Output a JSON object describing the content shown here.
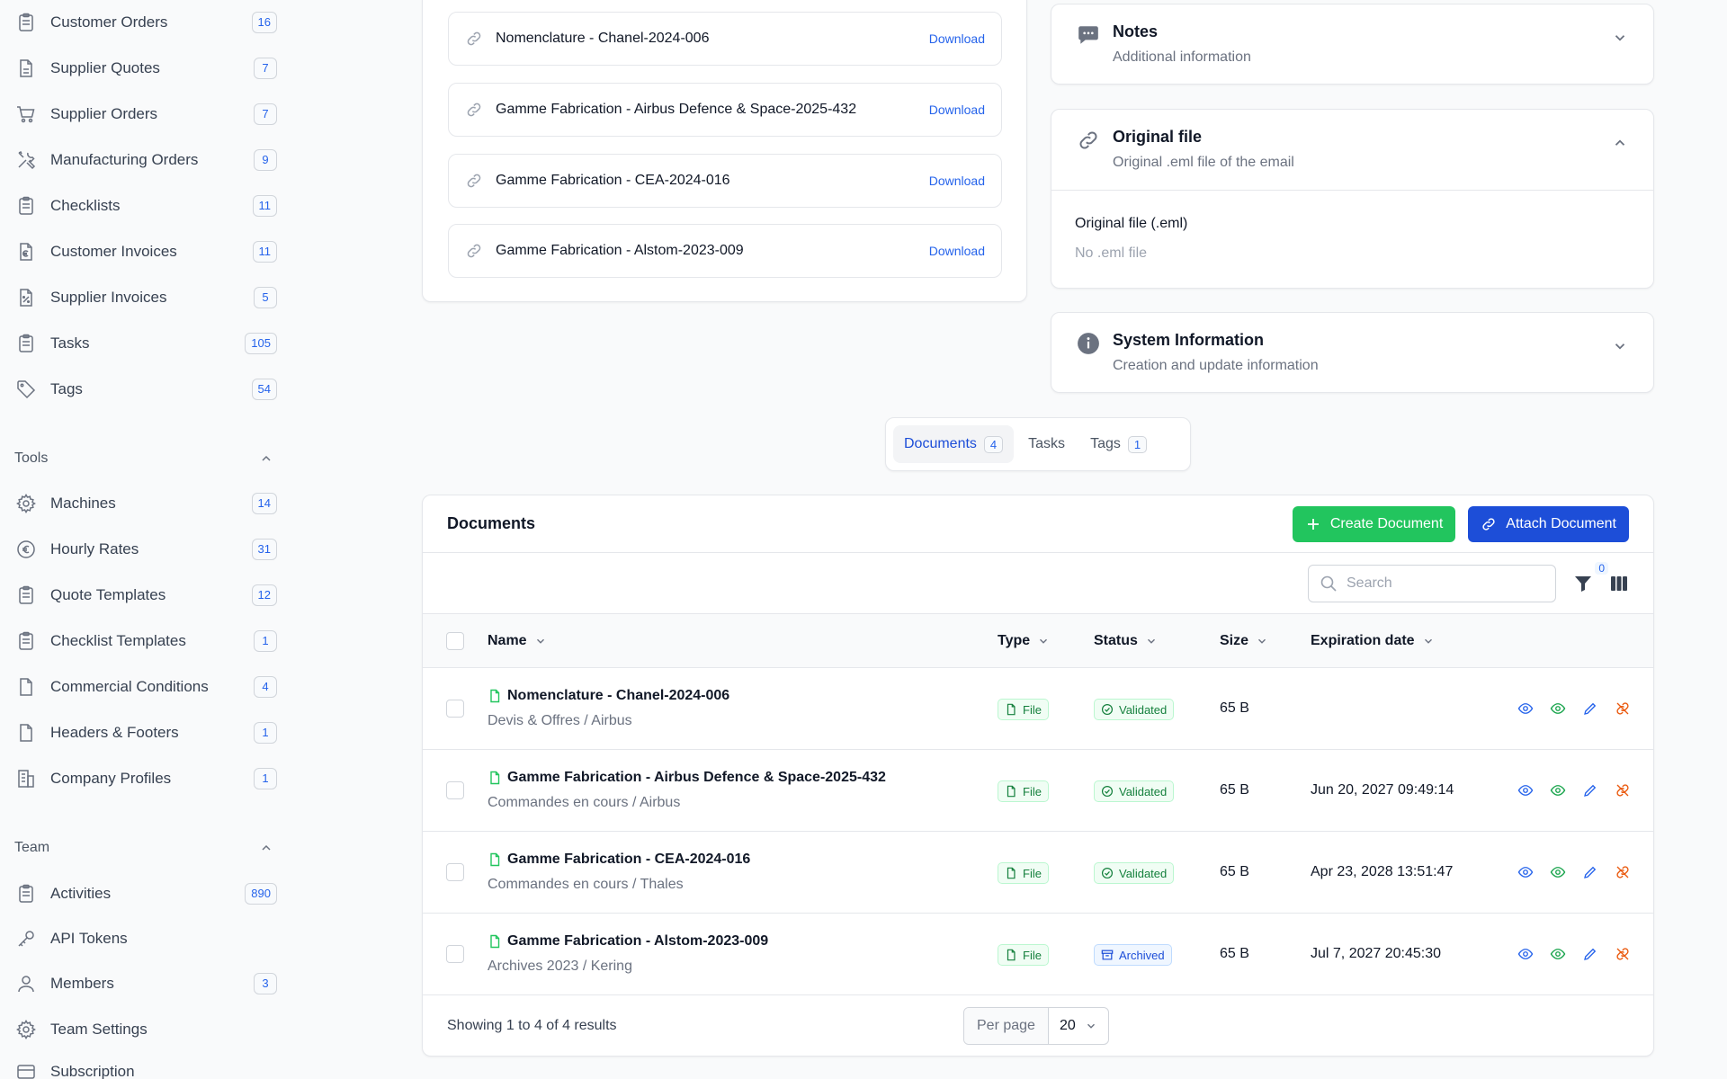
{
  "sidebar": {
    "items": [
      {
        "label": "Customer Orders",
        "count": "16",
        "icon": "clipboard-icon"
      },
      {
        "label": "Supplier Quotes",
        "count": "7",
        "icon": "document-icon"
      },
      {
        "label": "Supplier Orders",
        "count": "7",
        "icon": "cart-icon"
      },
      {
        "label": "Manufacturing Orders",
        "count": "9",
        "icon": "tools-icon"
      },
      {
        "label": "Checklists",
        "count": "11",
        "icon": "clipboard-icon"
      },
      {
        "label": "Customer Invoices",
        "count": "11",
        "icon": "euro-document-icon"
      },
      {
        "label": "Supplier Invoices",
        "count": "5",
        "icon": "percent-document-icon"
      },
      {
        "label": "Tasks",
        "count": "105",
        "icon": "clipboard-icon"
      },
      {
        "label": "Tags",
        "count": "54",
        "icon": "tag-icon"
      }
    ],
    "tools_title": "Tools",
    "tools": [
      {
        "label": "Machines",
        "count": "14",
        "icon": "gear-icon"
      },
      {
        "label": "Hourly Rates",
        "count": "31",
        "icon": "euro-icon"
      },
      {
        "label": "Quote Templates",
        "count": "12",
        "icon": "clipboard-icon"
      },
      {
        "label": "Checklist Templates",
        "count": "1",
        "icon": "clipboard-icon"
      },
      {
        "label": "Commercial Conditions",
        "count": "4",
        "icon": "document-icon"
      },
      {
        "label": "Headers & Footers",
        "count": "1",
        "icon": "document-icon"
      },
      {
        "label": "Company Profiles",
        "count": "1",
        "icon": "building-icon"
      }
    ],
    "team_title": "Team",
    "team": [
      {
        "label": "Activities",
        "count": "890",
        "icon": "clipboard-icon"
      },
      {
        "label": "API Tokens",
        "count": "",
        "icon": "key-icon"
      },
      {
        "label": "Members",
        "count": "3",
        "icon": "user-icon"
      },
      {
        "label": "Team Settings",
        "count": "",
        "icon": "gear-icon"
      },
      {
        "label": "Subscription",
        "count": "",
        "icon": "card-icon"
      }
    ]
  },
  "attachments": {
    "download_label": "Download",
    "items": [
      "Nomenclature - Chanel-2024-006",
      "Gamme Fabrication - Airbus Defence & Space-2025-432",
      "Gamme Fabrication - CEA-2024-016",
      "Gamme Fabrication - Alstom-2023-009"
    ]
  },
  "notes": {
    "title": "Notes",
    "subtitle": "Additional information"
  },
  "original_file": {
    "title": "Original file",
    "subtitle": "Original .eml file of the email",
    "field_label": "Original file (.eml)",
    "field_value": "No .eml file"
  },
  "system_info": {
    "title": "System Information",
    "subtitle": "Creation and update information"
  },
  "tabs": [
    {
      "label": "Documents",
      "count": "4"
    },
    {
      "label": "Tasks",
      "count": ""
    },
    {
      "label": "Tags",
      "count": "1"
    }
  ],
  "documents": {
    "title": "Documents",
    "create_label": "Create Document",
    "attach_label": "Attach Document",
    "search_placeholder": "Search",
    "filter_count": "0",
    "columns": {
      "name": "Name",
      "type": "Type",
      "status": "Status",
      "size": "Size",
      "expiration": "Expiration date"
    },
    "rows": [
      {
        "name": "Nomenclature - Chanel-2024-006",
        "path": "Devis & Offres / Airbus",
        "type": "File",
        "status": "Validated",
        "size": "65 B",
        "expiration": ""
      },
      {
        "name": "Gamme Fabrication - Airbus Defence & Space-2025-432",
        "path": "Commandes en cours / Airbus",
        "type": "File",
        "status": "Validated",
        "size": "65 B",
        "expiration": "Jun 20, 2027 09:49:14"
      },
      {
        "name": "Gamme Fabrication - CEA-2024-016",
        "path": "Commandes en cours / Thales",
        "type": "File",
        "status": "Validated",
        "size": "65 B",
        "expiration": "Apr 23, 2028 13:51:47"
      },
      {
        "name": "Gamme Fabrication - Alstom-2023-009",
        "path": "Archives 2023 / Kering",
        "type": "File",
        "status": "Archived",
        "size": "65 B",
        "expiration": "Jul 7, 2027 20:45:30"
      }
    ],
    "showing": "Showing 1 to 4 of 4 results",
    "per_page_label": "Per page",
    "per_page_value": "20"
  },
  "colors": {
    "accent": "#1d4ed8",
    "success": "#22c55e",
    "danger_action": "#ea580c"
  }
}
